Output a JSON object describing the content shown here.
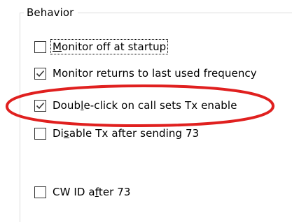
{
  "group": {
    "title": "Behavior"
  },
  "options": [
    {
      "pre": "",
      "key": "M",
      "post": "onitor off at startup",
      "checked": false
    },
    {
      "pre": "Monitor returns to last used frequency",
      "key": "",
      "post": "",
      "checked": true
    },
    {
      "pre": "Doub",
      "key": "l",
      "post": "e-click on call sets Tx enable",
      "checked": true
    },
    {
      "pre": "Di",
      "key": "s",
      "post": "able Tx after sending 73",
      "checked": false
    },
    {
      "pre": "CW ID a",
      "key": "f",
      "post": "ter 73",
      "checked": false
    }
  ],
  "annotation": {
    "color": "#e0201f"
  }
}
